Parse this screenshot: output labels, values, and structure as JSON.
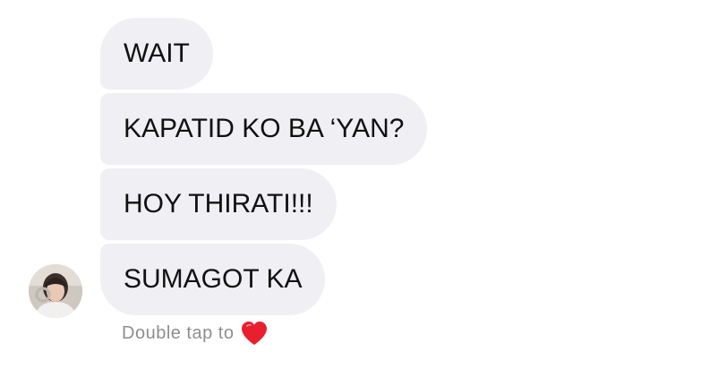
{
  "messages": [
    {
      "text": "WAIT"
    },
    {
      "text": "KAPATID KO BA ‘YAN?"
    },
    {
      "text": "HOY THIRATI!!!"
    },
    {
      "text": "SUMAGOT KA"
    }
  ],
  "footer": {
    "hint_text": "Double tap to",
    "icon": "heart-icon"
  },
  "colors": {
    "bubble_background": "#efeff4",
    "bubble_text": "#111111",
    "hint_text": "#8e8e8e",
    "heart": "#e8202e"
  }
}
